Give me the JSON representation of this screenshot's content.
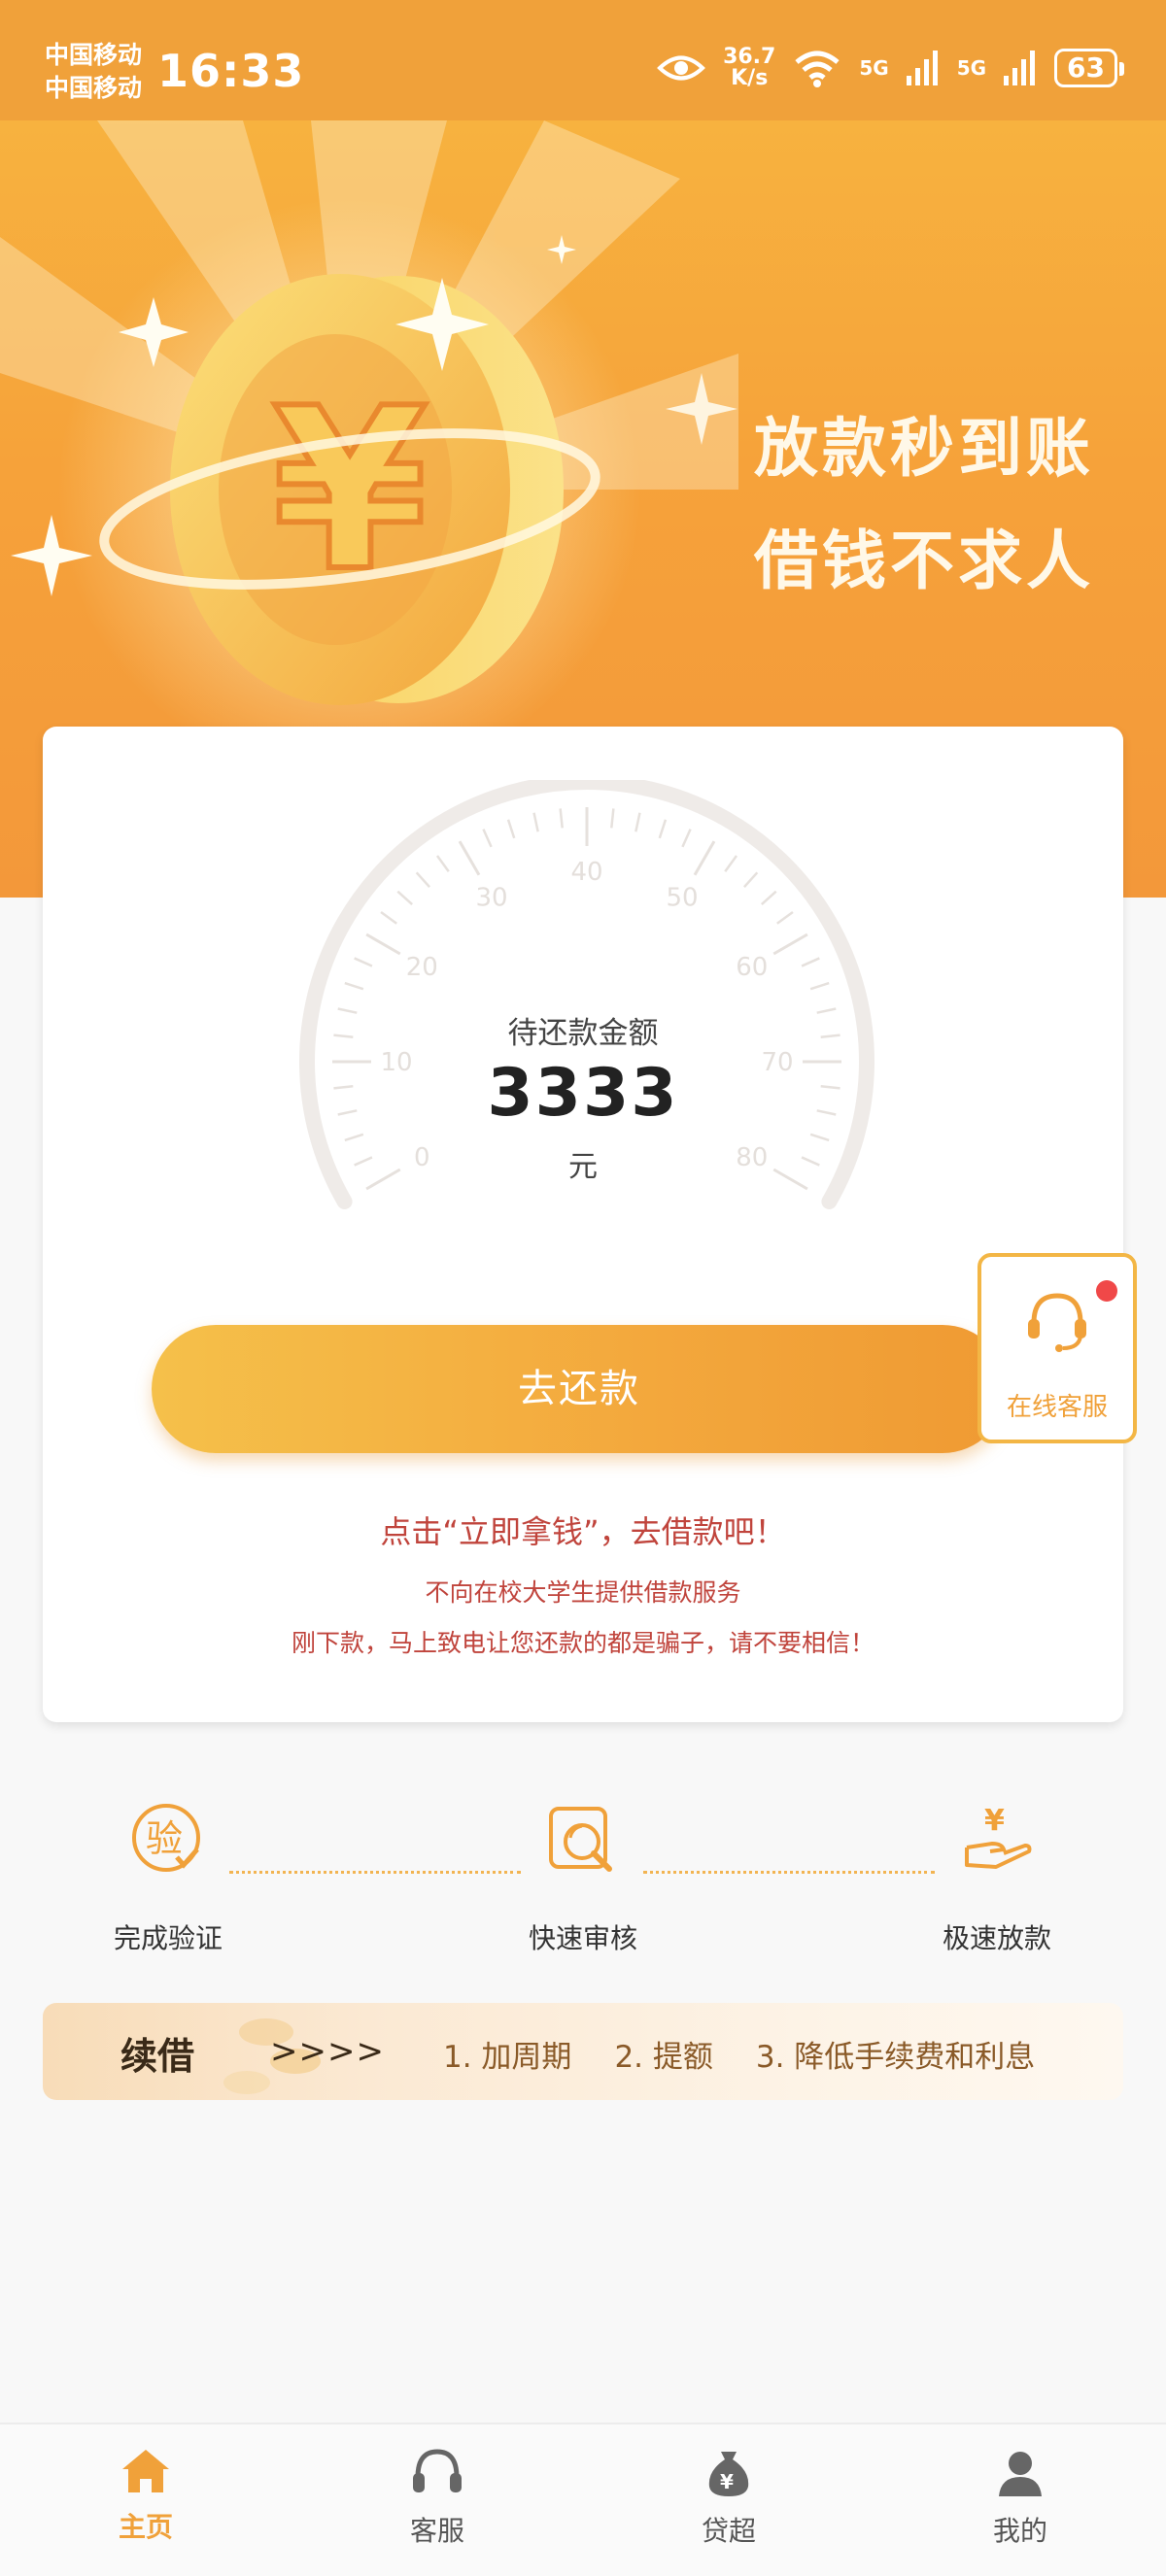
{
  "status_bar": {
    "carrier1": "中国移动",
    "carrier2": "中国移动",
    "time": "16:33",
    "net_speed_top": "36.7",
    "net_speed_bottom": "K/s",
    "sig1": "5G",
    "sig2": "5G",
    "battery": "63"
  },
  "banner": {
    "line1": "放款秒到账",
    "line2": "借钱不求人",
    "coin_symbol": "¥"
  },
  "gauge": {
    "ticks": [
      "0",
      "10",
      "20",
      "30",
      "40",
      "50",
      "60",
      "70",
      "80"
    ],
    "label": "待还款金额",
    "amount": "3333",
    "unit": "元"
  },
  "actions": {
    "repay_button": "去还款"
  },
  "notices": {
    "line1": "点击“立即拿钱”，去借款吧！",
    "line2": "不向在校大学生提供借款服务",
    "line3": "刚下款，马上致电让您还款的都是骗子，请不要相信！"
  },
  "float_service": {
    "label": "在线客服"
  },
  "steps": [
    {
      "label": "完成验证",
      "icon": "verify-icon",
      "glyph": "验"
    },
    {
      "label": "快速审核",
      "icon": "review-search-icon"
    },
    {
      "label": "极速放款",
      "icon": "fast-loan-icon",
      "glyph": "¥"
    }
  ],
  "renew": {
    "title": "续借",
    "arrows": ">>>>",
    "items": [
      "1. 加周期",
      "2. 提额",
      "3. 降低手续费和利息"
    ]
  },
  "bottom_nav": [
    {
      "label": "主页",
      "icon": "home-icon",
      "active": true
    },
    {
      "label": "客服",
      "icon": "headset-icon",
      "active": false
    },
    {
      "label": "贷超",
      "icon": "money-bag-icon",
      "glyph": "¥",
      "active": false
    },
    {
      "label": "我的",
      "icon": "user-icon",
      "active": false
    }
  ],
  "colors": {
    "accent": "#f0a13a",
    "warning_text": "#c0443c",
    "button_start": "#f5c04a",
    "button_end": "#ef9a33"
  }
}
